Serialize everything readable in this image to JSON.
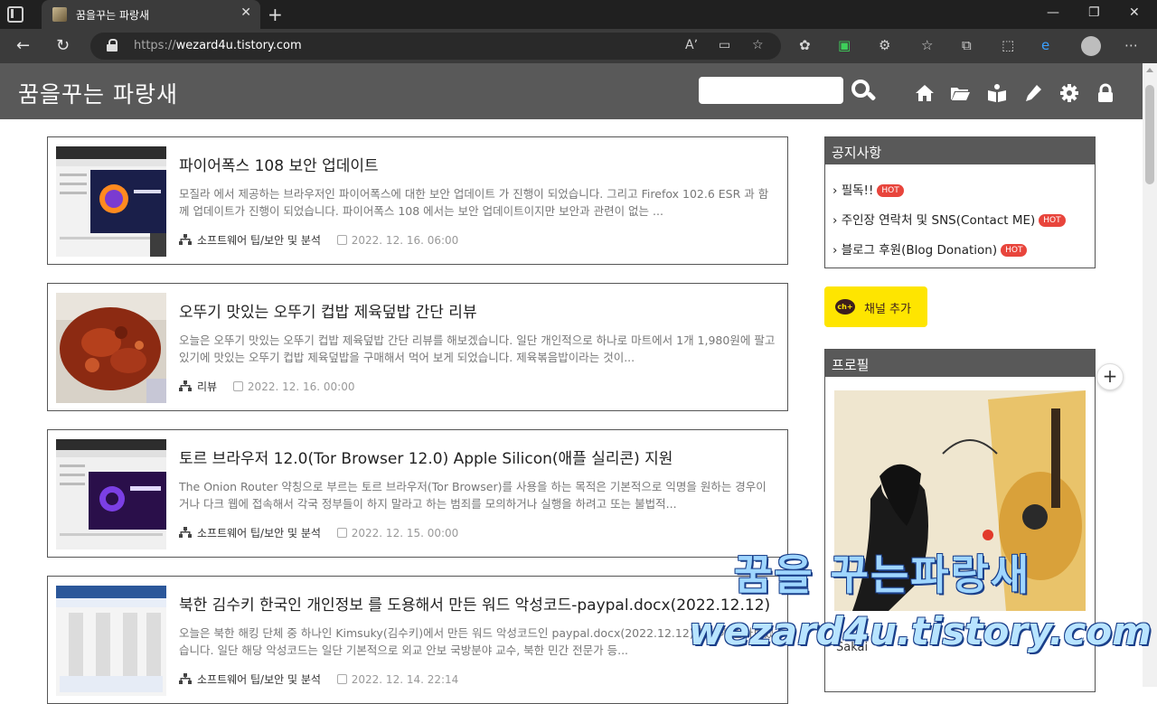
{
  "browser": {
    "tab_title": "꿈을꾸는 파랑새",
    "url_scheme": "https://",
    "url_host": "wezard4u.tistory.com"
  },
  "site": {
    "title": "꿈을꾸는 파랑새",
    "search_placeholder": ""
  },
  "posts": [
    {
      "title": "파이어폭스 108 보안 업데이트",
      "excerpt": "모질라 에서 제공하는 브라우저인 파이어폭스에 대한 보안 업데이트 가 진행이 되었습니다. 그리고 Firefox 102.6 ESR 과 함께 업데이트가 진행이 되었습니다. 파이어폭스 108 에서는 보안 업데이트이지만 보안과 관련이 없는 ...",
      "category": "소프트웨어 팁/보안 및 분석",
      "date": "2022. 12. 16. 06:00"
    },
    {
      "title": "오뚜기 맛있는 오뚜기 컵밥 제육덮밥 간단 리뷰",
      "excerpt": "오늘은 오뚜기 맛있는 오뚜기 컵밥 제육덮밥 간단 리뷰를 해보겠습니다. 일단 개인적으로 하나로 마트에서 1개 1,980원에 팔고 있기에 맛있는 오뚜기 컵밥 제육덮밥을 구매해서 먹어 보게 되었습니다. 제육볶음밥이라는 것이...",
      "category": "리뷰",
      "date": "2022. 12. 16. 00:00"
    },
    {
      "title": "토르 브라우저 12.0(Tor Browser 12.0) Apple Silicon(애플 실리콘) 지원",
      "excerpt": "The Onion Router 약칭으로 부르는 토르 브라우저(Tor Browser)를 사용을 하는 목적은 기본적으로 익명을 원하는 경우이거나 다크 웹에 접속해서 각국 정부들이 하지 말라고 하는 범죄를 모의하거나 실행을 하려고 또는 불법적...",
      "category": "소프트웨어 팁/보안 및 분석",
      "date": "2022. 12. 15. 00:00"
    },
    {
      "title": "북한 김수키 한국인 개인정보 를 도용해서 만든 워드 악성코드-paypal.docx(2022.12.12)",
      "excerpt": "오늘은 북한 해킹 단체 중 하나인 Kimsuky(김수키)에서 만든 워드 악성코드인 paypal.docx(2022.12.12)에 대해 알아보겠습니다. 일단 해당 악성코드는 일단 기본적으로 외교 안보 국방분야 교수, 북한 민간 전문가 등...",
      "category": "소프트웨어 팁/보안 및 분석",
      "date": "2022. 12. 14. 22:14"
    }
  ],
  "sidebar": {
    "notice_title": "공지사항",
    "notices": [
      {
        "label": "필독!!",
        "badge": "HOT"
      },
      {
        "label": "주인장 연락처 및 SNS(Contact ME)",
        "badge": "HOT"
      },
      {
        "label": "블로그 후원(Blog Donation)",
        "badge": "HOT"
      }
    ],
    "kakao_label": "채널 추가",
    "kakao_icon_text": "ch+",
    "profile_title": "프로필",
    "profile_name": "Sakai"
  },
  "watermark": {
    "line1": "꿈을 꾸는파랑새",
    "line2": "wezard4u.tistory.com"
  },
  "colors": {
    "header_bg": "#595959",
    "hot_badge": "#e8453c",
    "kakao_yellow": "#fee500"
  }
}
